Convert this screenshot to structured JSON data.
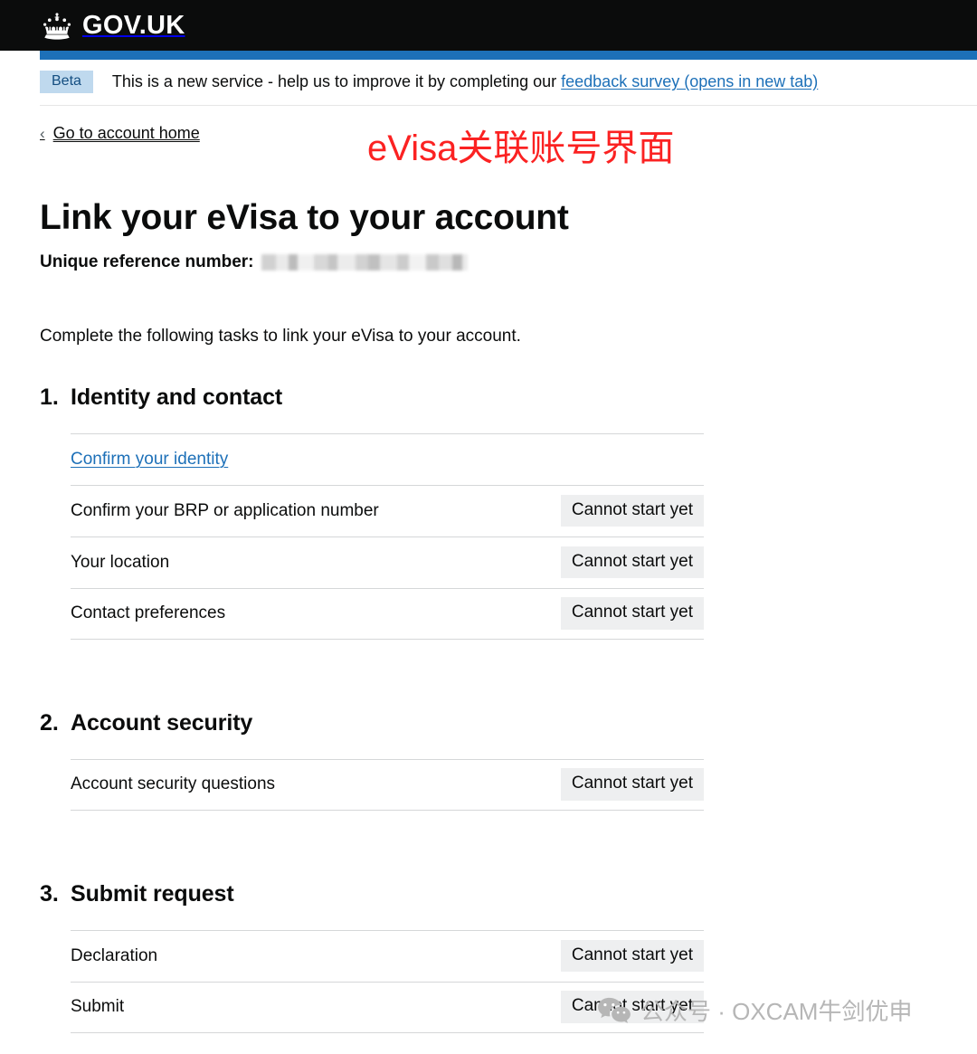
{
  "header": {
    "logo_icon": "crown-icon",
    "wordmark": "GOV.UK"
  },
  "phase_banner": {
    "tag": "Beta",
    "text_before_link": "This is a new service - help us to improve it by completing our ",
    "link_text": "feedback survey (opens in new tab)"
  },
  "back_link": {
    "chevron_icon": "chevron-left-icon",
    "label": "Go to account home"
  },
  "annotation": {
    "text": "eVisa关联账号界面",
    "color": "#fb2222"
  },
  "main": {
    "title": "Link your eVisa to your account",
    "reference_label": "Unique reference number:",
    "reference_value": "",
    "intro": "Complete the following tasks to link your eVisa to your account.",
    "sections": [
      {
        "number": "1.",
        "title": "Identity and contact",
        "tasks": [
          {
            "name": "Confirm your identity",
            "is_link": true,
            "status": ""
          },
          {
            "name": "Confirm your BRP or application number",
            "is_link": false,
            "status": "Cannot start yet"
          },
          {
            "name": "Your location",
            "is_link": false,
            "status": "Cannot start yet"
          },
          {
            "name": "Contact preferences",
            "is_link": false,
            "status": "Cannot start yet"
          }
        ]
      },
      {
        "number": "2.",
        "title": "Account security",
        "tasks": [
          {
            "name": "Account security questions",
            "is_link": false,
            "status": "Cannot start yet"
          }
        ]
      },
      {
        "number": "3.",
        "title": "Submit request",
        "tasks": [
          {
            "name": "Declaration",
            "is_link": false,
            "status": "Cannot start yet"
          },
          {
            "name": "Submit",
            "is_link": false,
            "status": "Cannot start yet"
          }
        ]
      }
    ]
  },
  "watermark": {
    "icon": "wechat-icon",
    "text": "公众号 · OXCAM牛剑优申"
  },
  "colors": {
    "header_background": "#0b0c0c",
    "accent_blue": "#1d70b8",
    "beta_tag_background": "#bfd9ee",
    "status_tag_background": "#eeeff0",
    "annotation_red": "#fb2222"
  }
}
